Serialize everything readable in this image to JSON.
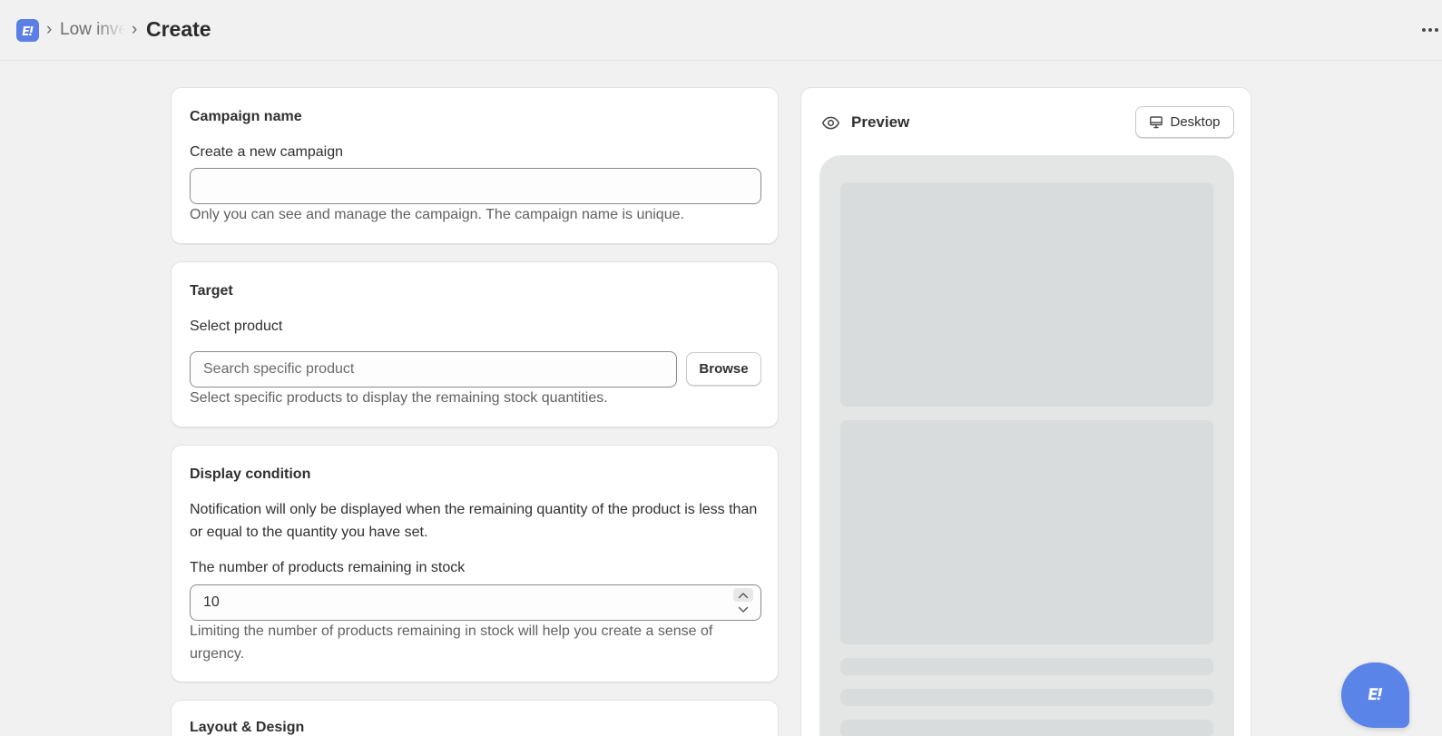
{
  "breadcrumb": {
    "previous": "Low inventory",
    "separator": "›",
    "current": "Create"
  },
  "campaign": {
    "title": "Campaign name",
    "label": "Create a new campaign",
    "value": "",
    "help": "Only you can see and manage the campaign. The campaign name is unique."
  },
  "target": {
    "title": "Target",
    "label": "Select product",
    "placeholder": "Search specific product",
    "browse_label": "Browse",
    "help": "Select specific products to display the remaining stock quantities."
  },
  "display_condition": {
    "title": "Display condition",
    "description": "Notification will only be displayed when the remaining quantity of the product is less than or equal to the quantity you have set.",
    "label": "The number of products remaining in stock",
    "value": "10",
    "help": "Limiting the number of products remaining in stock will help you create a sense of urgency."
  },
  "layout": {
    "title": "Layout & Design"
  },
  "preview": {
    "title": "Preview",
    "device_label": "Desktop"
  },
  "icons": {
    "app_logo": "app-logo-icon",
    "more": "more-horizontal-icon",
    "preview": "eye-icon",
    "device": "desktop-icon",
    "stepper_up": "chevron-up-icon",
    "stepper_down": "chevron-down-icon",
    "chat": "chat-launcher-icon"
  },
  "colors": {
    "brand": "#5b7fe6",
    "chat": "#5b84e8"
  }
}
